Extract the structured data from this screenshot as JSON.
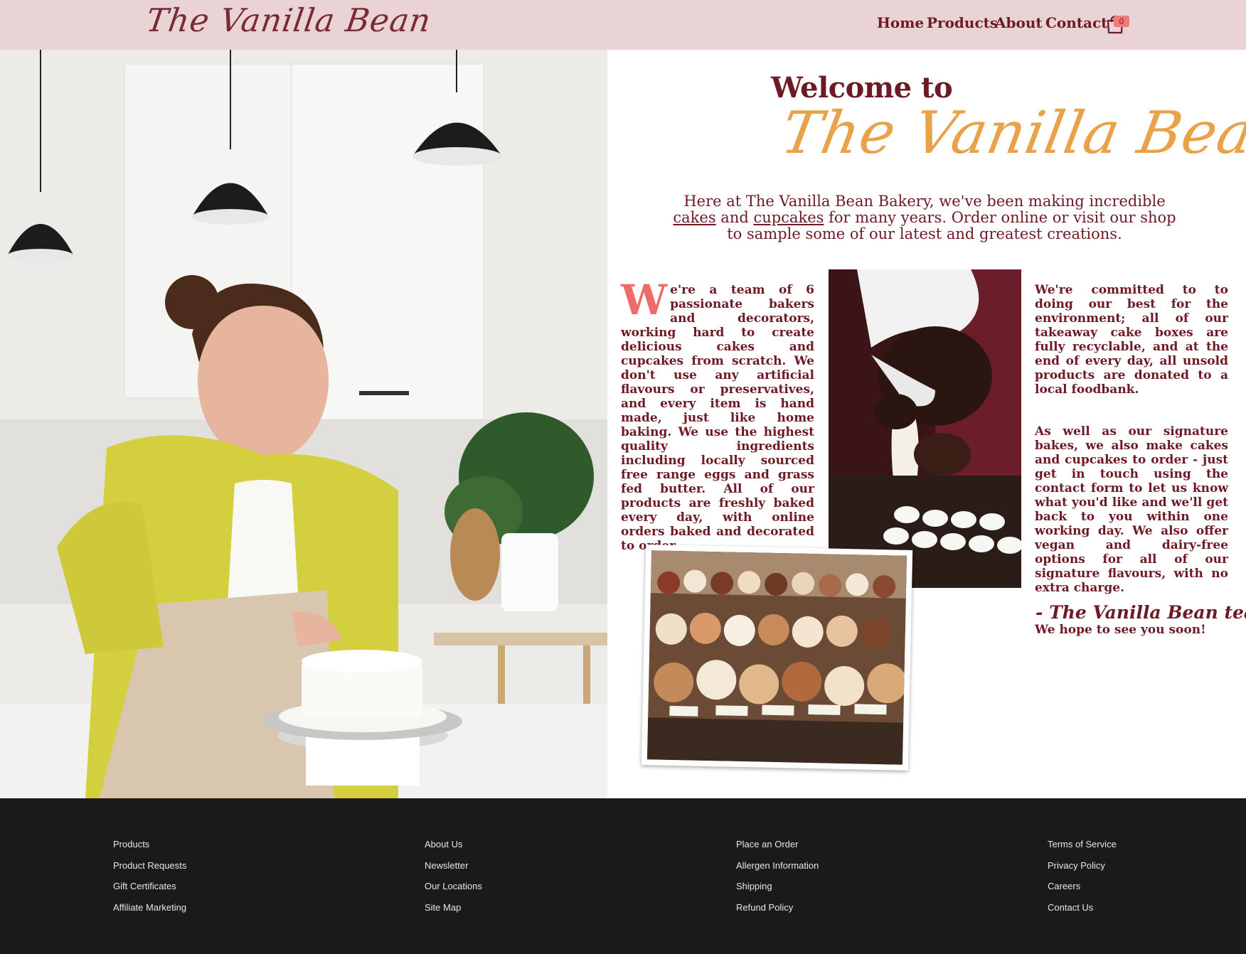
{
  "header": {
    "logo_text": "The Vanilla Bean",
    "nav": [
      "Home",
      "Products",
      "About",
      "Contact"
    ],
    "cart_count": "0"
  },
  "welcome": {
    "line1": "Welcome to",
    "brand": "The Vanilla Bean",
    "intro_before_cakes": "Here at The Vanilla Bean Bakery, we've been making incredible ",
    "intro_link_cakes": "cakes",
    "intro_and": " and ",
    "intro_link_cupcakes": "cupcakes",
    "intro_after": " for many years. Order online or visit our shop to sample some of our latest and greatest creations."
  },
  "about": {
    "dropcap": "W",
    "left_text": "e're a team of 6 passionate bakers and decorators, working hard to create delicious cakes and cupcakes from scratch. We don't use any artificial flavours or preservatives, and every item is hand made, just like home baking. We use the highest quality ingredients including locally sourced free range eggs and grass fed butter. All of our products are freshly baked every day, with online orders baked and decorated to order.",
    "right_p1": "We're committed to to doing our best for the environment; all of our takeaway cake boxes are fully recyclable, and at the end of every day, all unsold products are donated to a local foodbank.",
    "right_p2": "As well as our signature bakes, we also make cakes and cupcakes to order - just get in touch using the contact form to let us know what you'd like and we'll get back to you within one working day. We also offer vegan and dairy-free options for all of our signature flavours, with no extra charge.",
    "right_p3": "We hope to see you soon!",
    "signoff": "- The Vanilla Bean team"
  },
  "footer": {
    "col1": [
      "Products",
      "Product Requests",
      "Gift Certificates",
      "Affiliate Marketing"
    ],
    "col2": [
      "About Us",
      "Newsletter",
      "Our Locations",
      "Site Map"
    ],
    "col3": [
      "Place an Order",
      "Allergen Information",
      "Shipping",
      "Refund Policy"
    ],
    "col4": [
      "Terms of Service",
      "Privacy Policy",
      "Careers",
      "Contact Us"
    ]
  },
  "colors": {
    "header_bg": "#ead3d4",
    "brand_maroon": "#6e1a24",
    "brand_orange": "#e9a24a",
    "accent_coral": "#ee6b6b",
    "footer_bg": "#1b1a1a"
  },
  "icons": [
    "cart-icon"
  ]
}
